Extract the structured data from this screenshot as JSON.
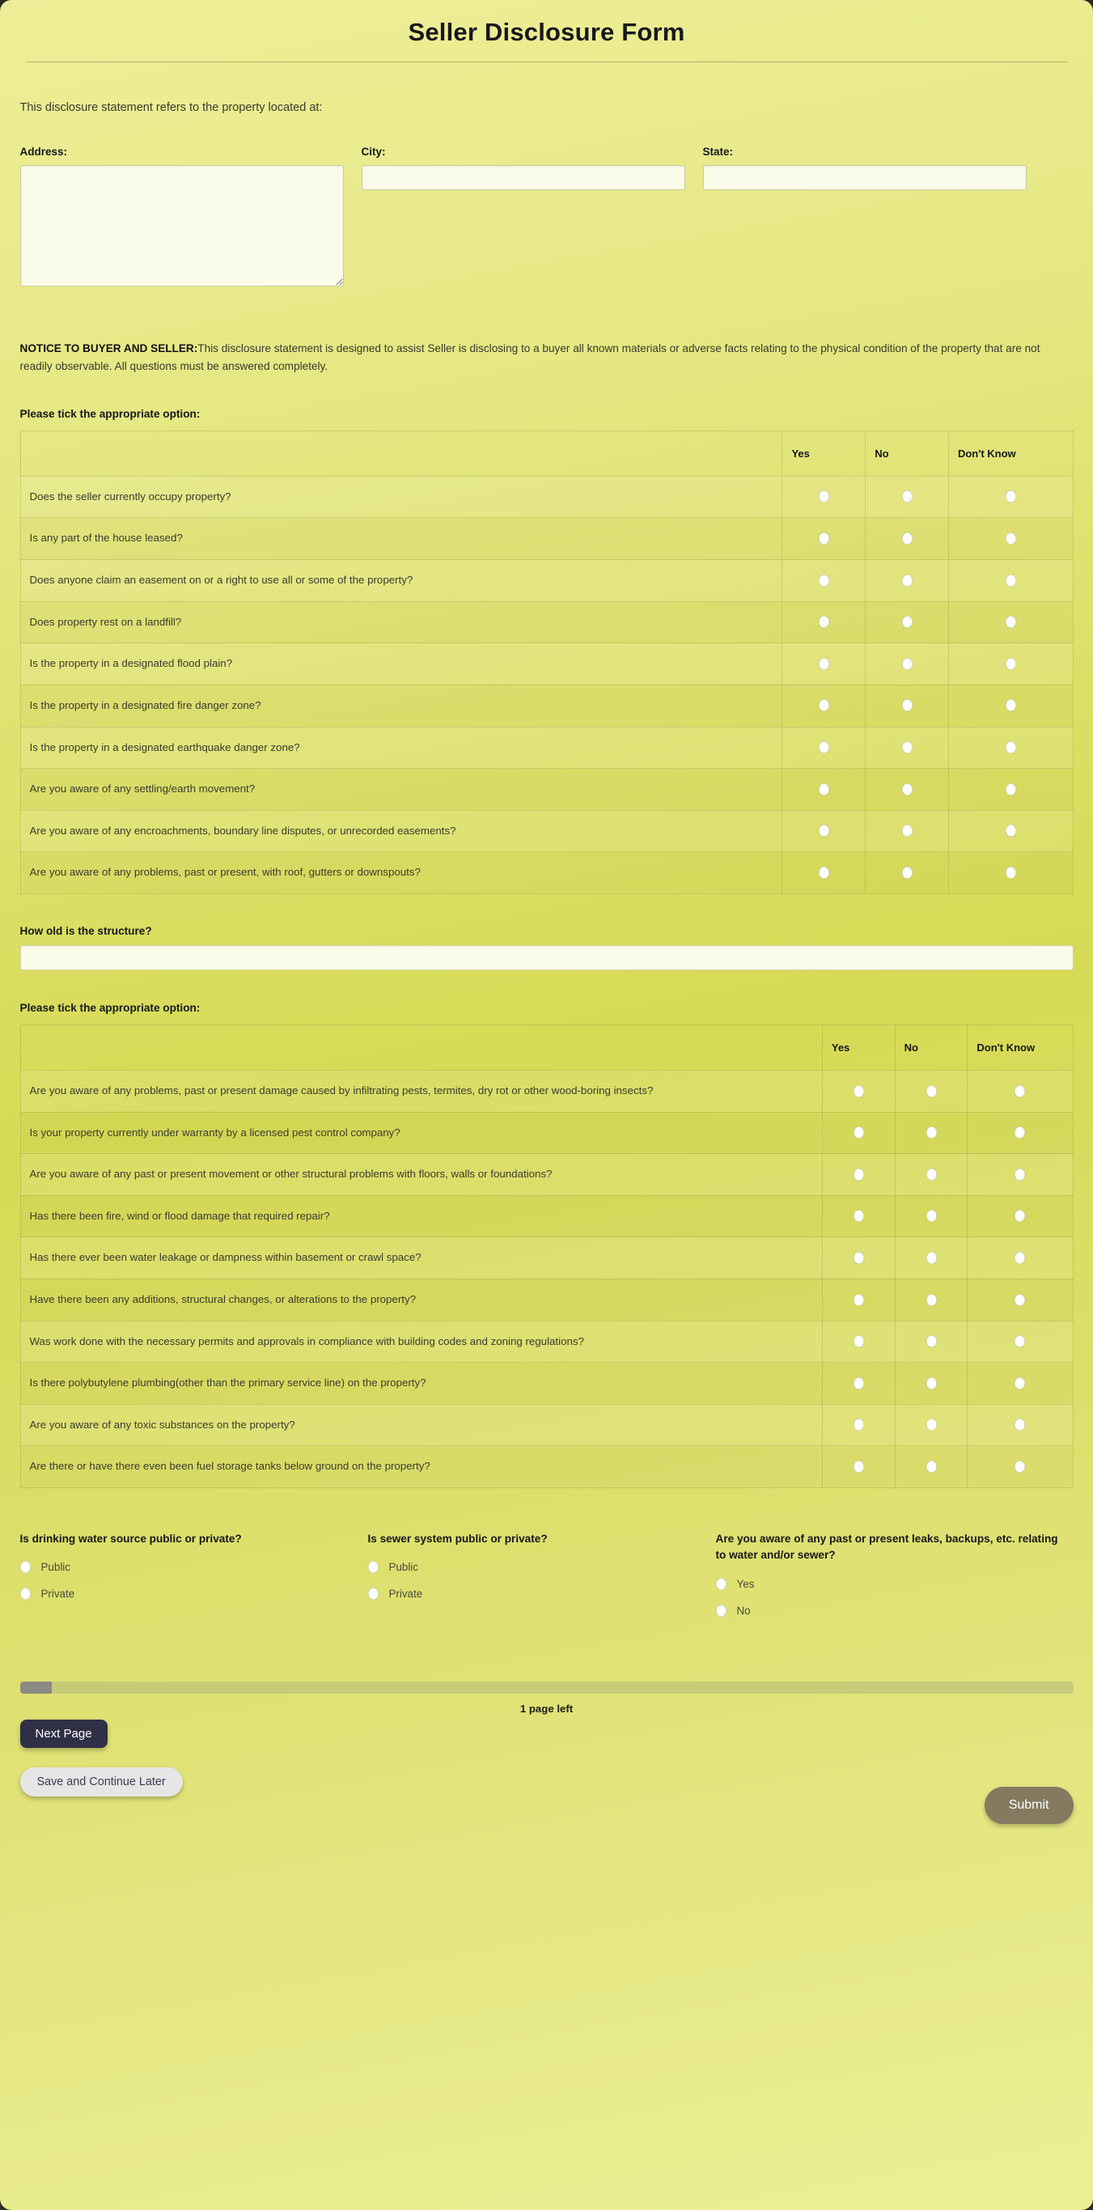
{
  "form": {
    "title": "Seller Disclosure Form",
    "intro": "This disclosure statement refers to the property located at:",
    "notice_bold": "NOTICE TO BUYER AND SELLER:",
    "notice_text": "This disclosure statement is designed to assist Seller is disclosing to a buyer all known materials or adverse facts relating to the physical condition of the property that are not readily observable. All questions must be answered completely."
  },
  "address_fields": {
    "address_label": "Address:",
    "address_value": "",
    "city_label": "City:",
    "city_value": "",
    "state_label": "State:",
    "state_value": ""
  },
  "section1": {
    "prompt": "Please tick the appropriate option:",
    "columns": [
      "",
      "Yes",
      "No",
      "Don't Know"
    ],
    "rows": [
      "Does the seller currently occupy property?",
      "Is any part of the house leased?",
      "Does anyone claim an easement on or a right to use all or some of the property?",
      "Does property rest on a landfill?",
      "Is the property in a designated flood plain?",
      "Is the property in a designated fire danger zone?",
      "Is the property in a designated earthquake danger zone?",
      "Are you aware of any settling/earth movement?",
      "Are you aware of any encroachments, boundary line disputes, or unrecorded easements?",
      "Are you aware of any problems, past or present, with roof, gutters or downspouts?"
    ]
  },
  "structure_question": {
    "label": "How old is the structure?",
    "value": ""
  },
  "section2": {
    "prompt": "Please tick the appropriate option:",
    "columns": [
      "",
      "Yes",
      "No",
      "Don't Know"
    ],
    "rows": [
      "Are you aware of any problems, past or present damage caused by infiltrating pests, termites, dry rot or other wood-boring insects?",
      "Is your property currently under warranty by a licensed pest control company?",
      "Are you aware of any past or present movement or other structural problems with floors, walls or foundations?",
      "Has there been fire, wind or flood damage that required repair?",
      "Has there ever been water leakage or dampness within basement or crawl space?",
      "Have there been any additions, structural changes, or alterations to the property?",
      "Was work done with the necessary permits and approvals in compliance with building codes and zoning regulations?",
      "Is there polybutylene plumbing(other than the primary service line) on the property?",
      "Are you aware of any toxic substances on the property?",
      "Are there or have there even been fuel storage tanks below ground on the property?"
    ]
  },
  "bottom_groups": [
    {
      "title": "Is drinking water source public or private?",
      "options": [
        "Public",
        "Private"
      ]
    },
    {
      "title": "Is sewer system public or private?",
      "options": [
        "Public",
        "Private"
      ]
    },
    {
      "title": "Are you aware of any past or present leaks, backups, etc. relating to water and/or sewer?",
      "options": [
        "Yes",
        "No"
      ]
    }
  ],
  "footer": {
    "pages_left": "1 page left",
    "next_label": "Next Page",
    "save_label": "Save and Continue Later",
    "submit_label": "Submit",
    "progress_percent": 3
  },
  "colors": {
    "background": "#d6da54",
    "input_bg": "#fbfbe9",
    "next_button": "#2f2f46",
    "save_button": "#e6e6e6",
    "submit_button": "#857a5f",
    "progress_fill": "#8a8a82"
  }
}
